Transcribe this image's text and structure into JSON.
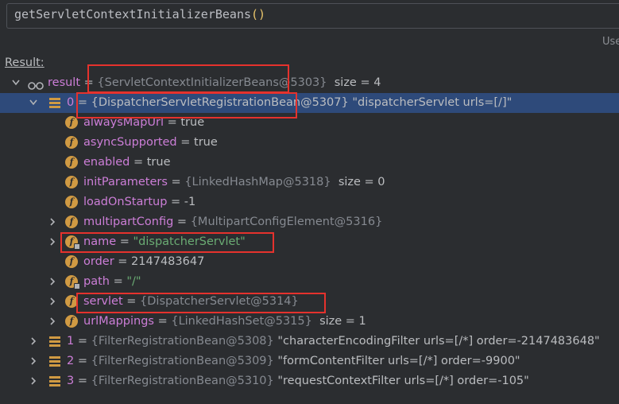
{
  "expression": {
    "name": "getServletContextInitializerBeans",
    "parens": "()"
  },
  "hint_text": "Use",
  "result_label": "Result:",
  "root": {
    "name": "result",
    "eq": " = ",
    "ref": "{ServletContextInitializerBeans@5303}",
    "suffix": "size = 4"
  },
  "item0": {
    "index": "0",
    "eq": " = ",
    "ref": "{DispatcherServletRegistrationBean@5307}",
    "desc": "\"dispatcherServlet urls=[/]\""
  },
  "fields": [
    {
      "name": "alwaysMapUrl",
      "eq": " = ",
      "value": "true"
    },
    {
      "name": "asyncSupported",
      "eq": " = ",
      "value": "true"
    },
    {
      "name": "enabled",
      "eq": " = ",
      "value": "true"
    },
    {
      "name": "initParameters",
      "eq": " = ",
      "ref": "{LinkedHashMap@5318}",
      "suffix": "size = 0"
    },
    {
      "name": "loadOnStartup",
      "eq": " = ",
      "value": "-1"
    },
    {
      "name": "multipartConfig",
      "eq": " = ",
      "ref": "{MultipartConfigElement@5316}"
    },
    {
      "name": "name",
      "eq": " = ",
      "value": "\"dispatcherServlet\""
    },
    {
      "name": "order",
      "eq": " = ",
      "value": "2147483647"
    },
    {
      "name": "path",
      "eq": " = ",
      "value": "\"/\""
    },
    {
      "name": "servlet",
      "eq": " = ",
      "ref": "{DispatcherServlet@5314}"
    },
    {
      "name": "urlMappings",
      "eq": " = ",
      "ref": "{LinkedHashSet@5315}",
      "suffix": "size = 1"
    }
  ],
  "items": [
    {
      "index": "1",
      "eq": " = ",
      "ref": "{FilterRegistrationBean@5308}",
      "desc": "\"characterEncodingFilter urls=[/*] order=-2147483648\""
    },
    {
      "index": "2",
      "eq": " = ",
      "ref": "{FilterRegistrationBean@5309}",
      "desc": "\"formContentFilter urls=[/*] order=-9900\""
    },
    {
      "index": "3",
      "eq": " = ",
      "ref": "{FilterRegistrationBean@5310}",
      "desc": "\"requestContextFilter urls=[/*] order=-105\""
    }
  ],
  "colors": {
    "background": "#2b2d30",
    "selection": "#2e4a7a",
    "field_icon": "#d09a43",
    "highlight_box": "#e5322d",
    "string": "#6aab73",
    "reference": "#868a91"
  }
}
